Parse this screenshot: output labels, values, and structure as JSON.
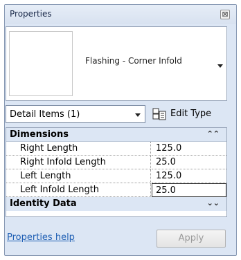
{
  "window": {
    "title": "Properties",
    "close_glyph": "⊠"
  },
  "type_selector": {
    "type_name": "Flashing - Corner Infold"
  },
  "filter": {
    "selected": "Detail Items (1)"
  },
  "edit_type": {
    "label": "Edit Type",
    "icon": "edit-type-icon"
  },
  "groups": [
    {
      "label": "Dimensions",
      "chevron": "⌃⌃",
      "expanded": true,
      "properties": [
        {
          "name": "Right Length",
          "value": "125.0"
        },
        {
          "name": "Right Infold Length",
          "value": "25.0"
        },
        {
          "name": "Left Length",
          "value": "125.0"
        },
        {
          "name": "Left Infold Length",
          "value": "25.0"
        }
      ]
    },
    {
      "label": "Identity Data",
      "chevron": "⌄⌄",
      "expanded": false,
      "properties": []
    }
  ],
  "footer": {
    "help_link": "Properties help",
    "apply_label": "Apply"
  },
  "colors": {
    "panel_bg": "#dce6f4",
    "link": "#1f5fb4",
    "disabled_text": "#9a9a9a"
  }
}
